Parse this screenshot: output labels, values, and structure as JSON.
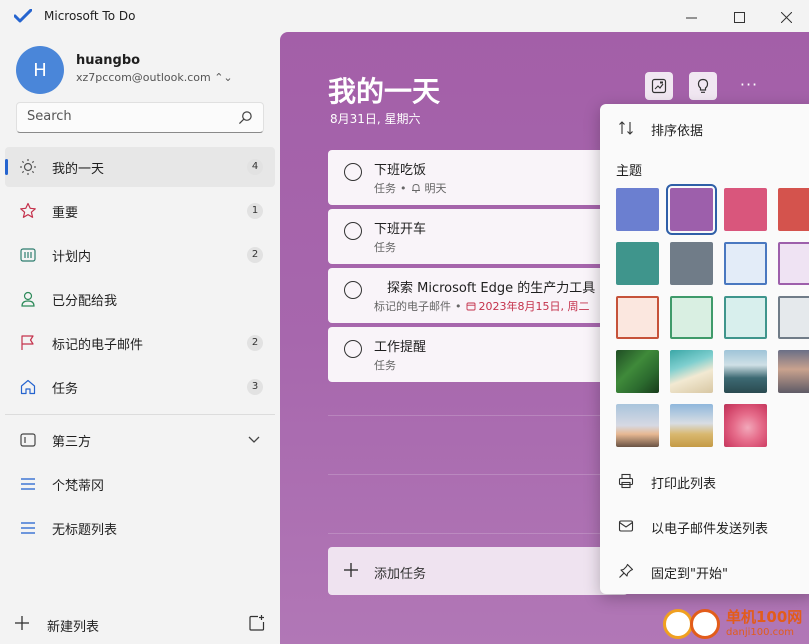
{
  "app": {
    "title": "Microsoft To Do",
    "window_controls": {
      "minimize": "—",
      "maximize": "☐",
      "close": "✕"
    }
  },
  "account": {
    "initial": "H",
    "name": "huangbo",
    "email": "xz7pccom@outlook.com ⌃⌄"
  },
  "search": {
    "placeholder": "Search"
  },
  "sidebar": {
    "items": [
      {
        "label": "我的一天",
        "count": "4",
        "icon": "sun-icon"
      },
      {
        "label": "重要",
        "count": "1",
        "icon": "star-icon"
      },
      {
        "label": "计划内",
        "count": "2",
        "icon": "calendar-icon"
      },
      {
        "label": "已分配给我",
        "count": "",
        "icon": "person-icon"
      },
      {
        "label": "标记的电子邮件",
        "count": "2",
        "icon": "flag-icon"
      },
      {
        "label": "任务",
        "count": "3",
        "icon": "home-icon"
      }
    ],
    "group_label": "第三方",
    "lists": [
      {
        "label": "个梵蒂冈",
        "icon": "list-icon"
      },
      {
        "label": "无标题列表",
        "icon": "list-icon"
      }
    ],
    "new_list_label": "新建列表"
  },
  "main": {
    "title": "我的一天",
    "date": "8月31日, 星期六",
    "more": "···",
    "tasks": [
      {
        "title": "下班吃饭",
        "list": "任务",
        "reminder": "明天"
      },
      {
        "title": "下班开车",
        "list": "任务"
      },
      {
        "title": "　探索 Microsoft Edge 的生产力工具",
        "list": "标记的电子邮件",
        "due": "2023年8月15日, 周二"
      },
      {
        "title": "工作提醒",
        "list": "任务"
      }
    ],
    "add_task_label": "添加任务"
  },
  "menu": {
    "sort_label": "排序依据",
    "theme_heading": "主题",
    "print_label": "打印此列表",
    "email_label": "以电子邮件发送列表",
    "pin_label": "固定到\"开始\"",
    "swatches": [
      {
        "color": "#6b7fd0",
        "selected": false
      },
      {
        "color": "#9d5fab",
        "selected": true
      },
      {
        "color": "#d9567c",
        "selected": false
      },
      {
        "color": "#d4534d",
        "selected": false
      },
      {
        "color": "#3f958c",
        "selected": false
      },
      {
        "color": "#707c88",
        "selected": false
      },
      {
        "color": "#e3ecf8",
        "selected": false
      },
      {
        "color": "#efe3f3",
        "selected": false
      },
      {
        "color": "#fbe7df",
        "selected": false
      },
      {
        "color": "#d9efe2",
        "selected": false
      },
      {
        "color": "#d8efed",
        "selected": false
      },
      {
        "color": "#e5e9ec",
        "selected": false
      }
    ],
    "photos": [
      "fern-photo",
      "beach-photo",
      "mountain-photo",
      "sunset-photo",
      "lighthouse-photo",
      "field-photo",
      "flower-photo"
    ]
  },
  "watermark": {
    "text": "单机100网",
    "sub": "danji100.com"
  }
}
